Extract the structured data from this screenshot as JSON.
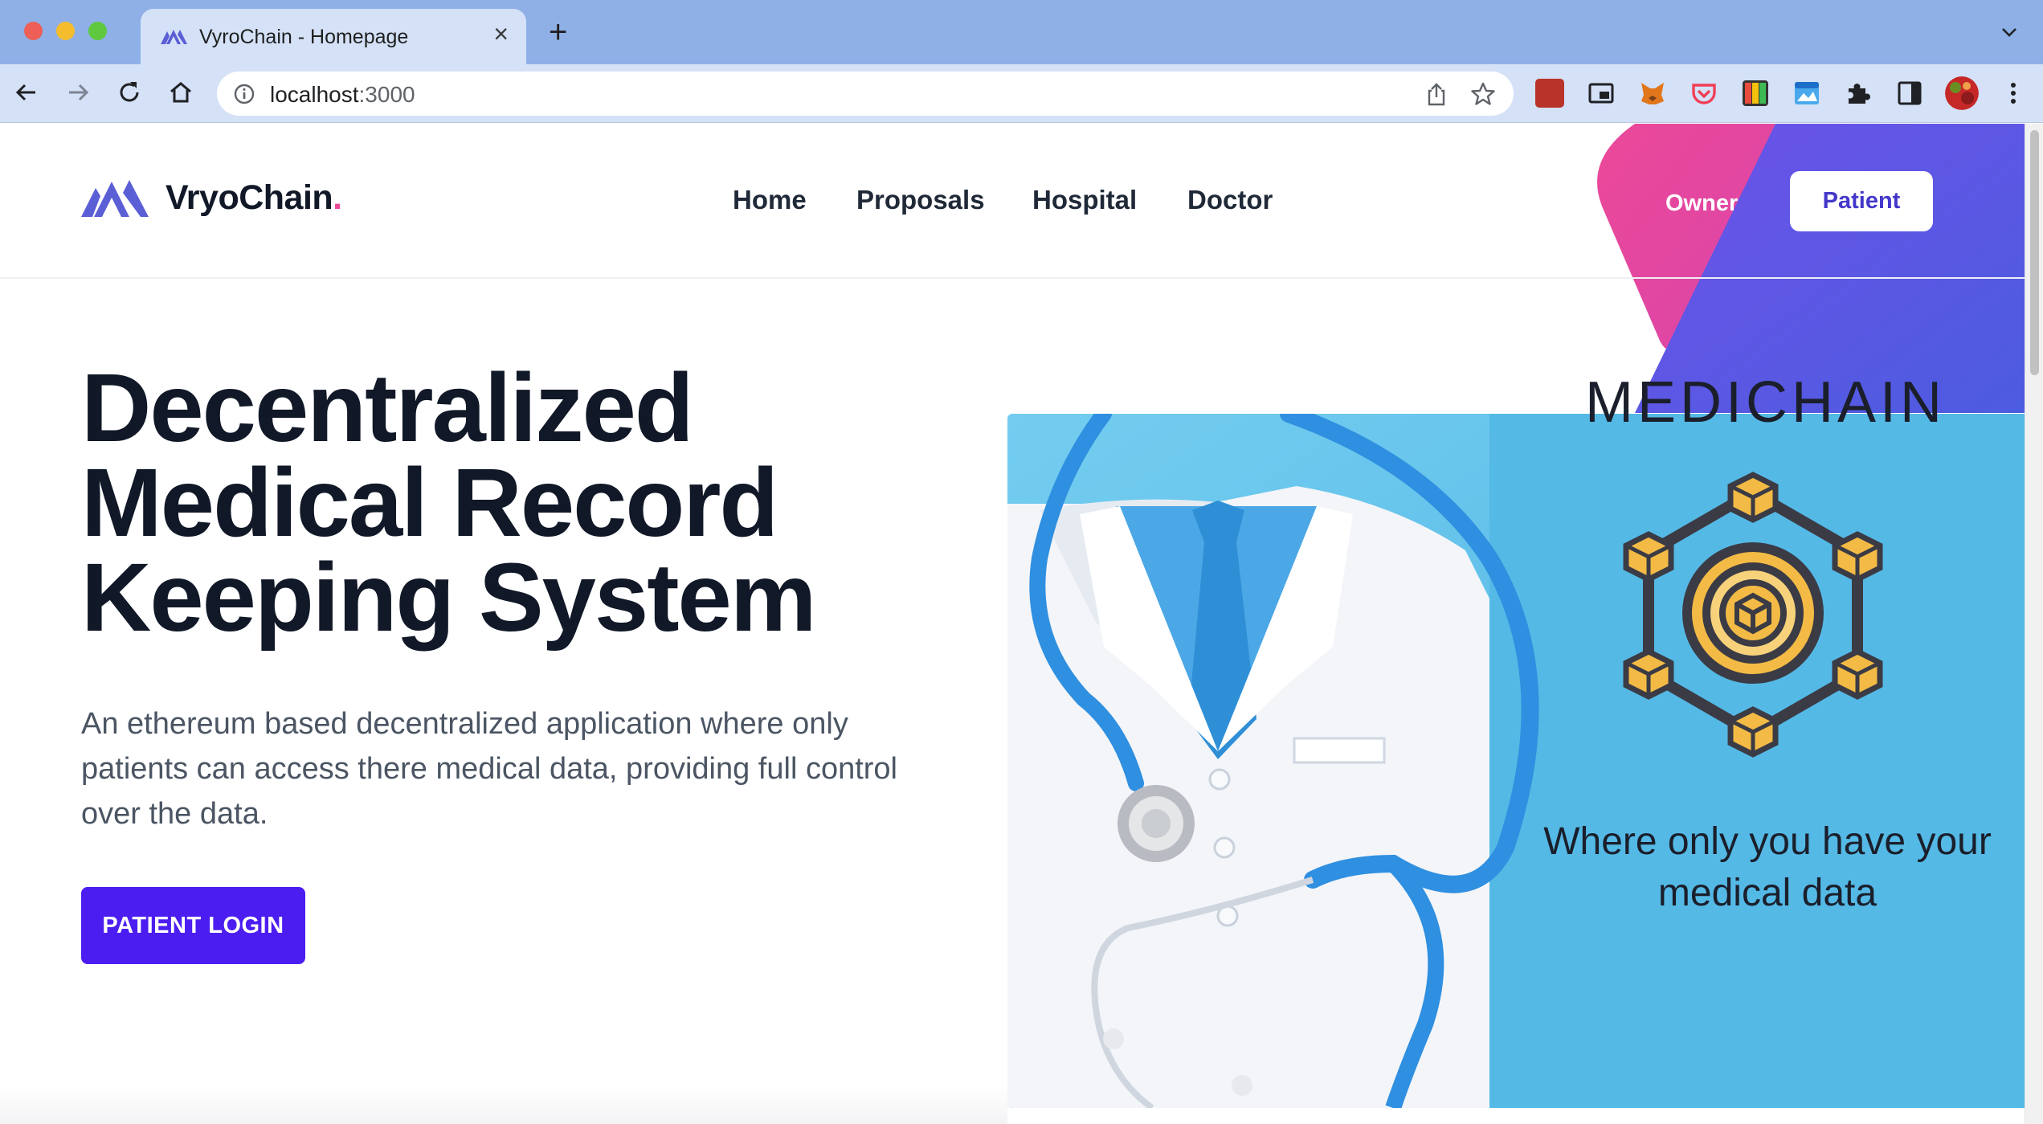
{
  "browser": {
    "tab_title": "VyroChain - Homepage",
    "tab_close": "×",
    "new_tab": "+",
    "url_host": "localhost",
    "url_port": ":3000",
    "extensions": [
      "extension-red-icon",
      "picture-in-picture-icon",
      "metamask-fox-icon",
      "pocket-icon",
      "color-extension-icon",
      "window-extension-icon",
      "puzzle-extensions-icon",
      "side-panel-icon",
      "profile-avatar"
    ]
  },
  "header": {
    "logo_text": "VryoChain",
    "logo_dot": ".",
    "nav": [
      "Home",
      "Proposals",
      "Hospital",
      "Doctor"
    ],
    "owner_label": "Owner",
    "patient_label": "Patient"
  },
  "hero": {
    "title_line1": "Decentralized",
    "title_line2": "Medical Record",
    "title_line3": "Keeping System",
    "description": "An ethereum based decentralized application where only patients can access there medical data, providing full control over the data.",
    "cta_label": "PATIENT LOGIN"
  },
  "image": {
    "title": "MEDICHAIN",
    "caption_line1": "Where only you have your",
    "caption_line2": "medical data"
  },
  "colors": {
    "accent": "#4c1df0",
    "brand_pink": "#ec4899",
    "brand_indigo": "#4338ca",
    "tab_bar": "#8eb0e6",
    "image_blue": "#5ec2ea",
    "chain_gold": "#f3bb45"
  }
}
